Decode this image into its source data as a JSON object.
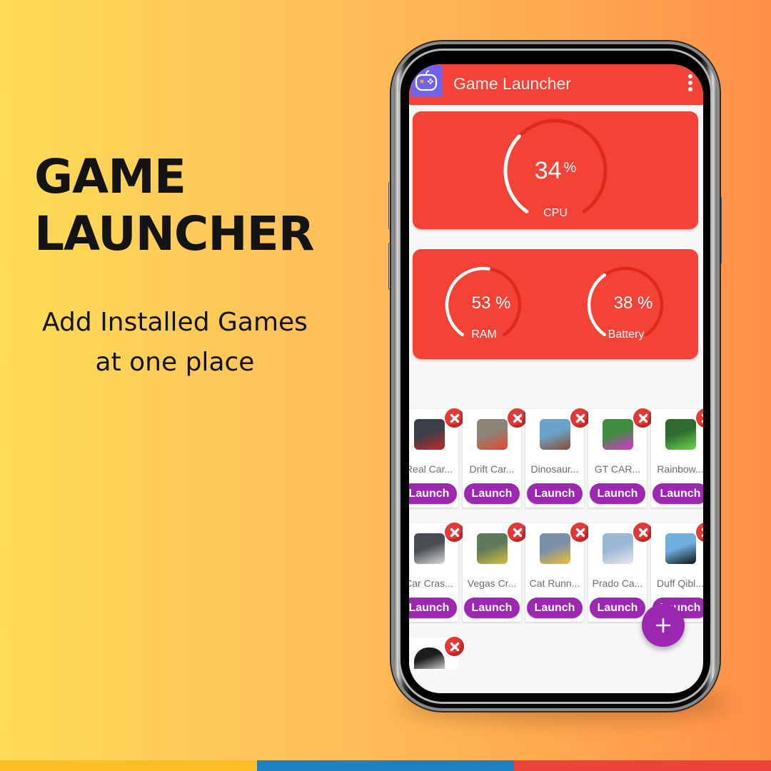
{
  "promo": {
    "title_line1": "GAME",
    "title_line2": "LAUNCHER",
    "subtitle_line1": "Add Installed Games",
    "subtitle_line2": "at one place"
  },
  "colors": {
    "appbar": "#f44336",
    "gauge_card": "#f44336",
    "launch_button": "#9c27b0",
    "fab": "#9c27b0",
    "remove_button": "#e53935",
    "app_icon_bg": "#7161ee",
    "strip": [
      "#fdbd24",
      "#1b80c4",
      "#ea443b"
    ]
  },
  "app": {
    "title": "Game Launcher",
    "icon": "gamepad-icon",
    "menu_icon": "more-vert-icon"
  },
  "gauges": {
    "cpu": {
      "label": "CPU",
      "value": 34,
      "value_text": "34",
      "unit": "%"
    },
    "ram": {
      "label": "RAM",
      "value": 53,
      "value_text": "53",
      "unit": "%"
    },
    "battery": {
      "label": "Battery",
      "value": 38,
      "value_text": "38",
      "unit": "%"
    }
  },
  "games": [
    {
      "name": "Real Car...",
      "button": "Launch",
      "thumb": [
        "#3a3f48",
        "#c62828"
      ]
    },
    {
      "name": "Drift Car...",
      "button": "Launch",
      "thumb": [
        "#8d8477",
        "#e6462a"
      ]
    },
    {
      "name": "Dinosaur...",
      "button": "Launch",
      "thumb": [
        "#6aa3c9",
        "#8a4a2b"
      ]
    },
    {
      "name": "GT CAR...",
      "button": "Launch",
      "thumb": [
        "#3f8d3f",
        "#e22fd5"
      ]
    },
    {
      "name": "Rainbow...",
      "button": "Launch",
      "thumb": [
        "#2f6b2f",
        "#6bd84a"
      ]
    },
    {
      "name": "Car Cras...",
      "button": "Launch",
      "thumb": [
        "#4a4e52",
        "#d9d9d9"
      ]
    },
    {
      "name": "Vegas Cr...",
      "button": "Launch",
      "thumb": [
        "#5f7a5a",
        "#d6c23a"
      ]
    },
    {
      "name": "Cat Runn...",
      "button": "Launch",
      "thumb": [
        "#7a8fa8",
        "#f0c030"
      ]
    },
    {
      "name": "Prado Ca...",
      "button": "Launch",
      "thumb": [
        "#9bb7d6",
        "#e8e8e8"
      ]
    },
    {
      "name": "Duff Qibl...",
      "button": "Launch",
      "thumb": [
        "#6fb0e0",
        "#111111"
      ]
    },
    {
      "name": "",
      "button": "",
      "thumb": [
        "#1d1d1d",
        "#c9c9c9"
      ]
    }
  ],
  "fab": {
    "icon": "plus-icon"
  }
}
